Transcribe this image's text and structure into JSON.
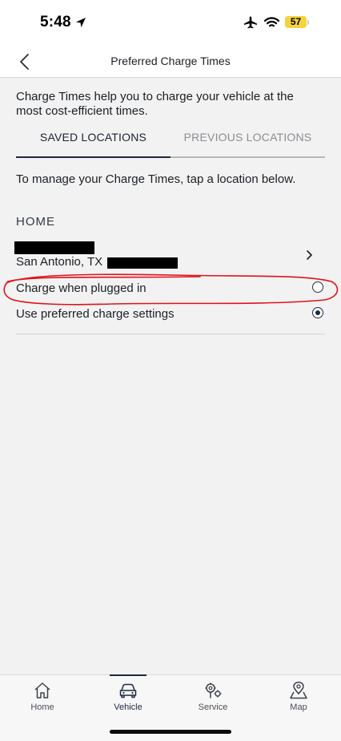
{
  "status_bar": {
    "time": "5:48",
    "battery": "57",
    "icons": [
      "location-arrow-icon",
      "airplane-icon",
      "wifi-icon",
      "battery-icon"
    ]
  },
  "header": {
    "title": "Preferred Charge Times",
    "back_icon": "chevron-left-icon"
  },
  "intro": "Charge Times help you to charge your vehicle at the most cost-efficient times.",
  "tabs": [
    {
      "label": "SAVED LOCATIONS",
      "active": true
    },
    {
      "label": "PREVIOUS LOCATIONS",
      "active": false
    }
  ],
  "manage_text": "To manage your Charge Times, tap a location below.",
  "section": {
    "title": "HOME",
    "location": {
      "city": "San Antonio, TX",
      "chevron_icon": "chevron-right-icon"
    },
    "options": [
      {
        "label": "Charge when plugged in",
        "selected": false
      },
      {
        "label": "Use preferred charge settings",
        "selected": true
      }
    ]
  },
  "tab_bar": {
    "items": [
      {
        "label": "Home",
        "icon": "home-icon",
        "active": false
      },
      {
        "label": "Vehicle",
        "icon": "car-icon",
        "active": true
      },
      {
        "label": "Service",
        "icon": "wrench-gear-icon",
        "active": false
      },
      {
        "label": "Map",
        "icon": "map-pin-icon",
        "active": false
      }
    ]
  },
  "colors": {
    "accent": "#1b2a44",
    "annotation": "#e0121a",
    "background": "#f2f2f2"
  }
}
